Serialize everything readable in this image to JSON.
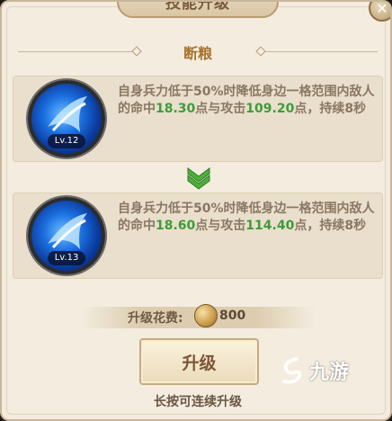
{
  "dialog": {
    "title": "技能升级",
    "close_icon": "close-icon"
  },
  "skill": {
    "name": "断粮"
  },
  "current": {
    "level": "Lv.12",
    "desc_before": "自身兵力低于50%时降低身边一格范围内敌人的命中",
    "accuracy": "18.30",
    "desc_mid": "点与攻击",
    "attack": "109.20",
    "desc_after": "点，持续8秒"
  },
  "next": {
    "level": "Lv.13",
    "desc_before": "自身兵力低于50%时降低身边一格范围内敌人的命中",
    "accuracy": "18.60",
    "desc_mid": "点与攻击",
    "attack": "114.40",
    "desc_after": "点，持续8秒"
  },
  "cost": {
    "label": "升级花费:",
    "value": "800",
    "icon": "coin-icon"
  },
  "upgrade_button": {
    "label": "升级"
  },
  "hint": "长按可连续升级",
  "watermark": {
    "text": "九游"
  },
  "colors": {
    "highlight": "#3f9b3a",
    "arrow": "#4caf3a",
    "panel": "#f3ecdf"
  }
}
